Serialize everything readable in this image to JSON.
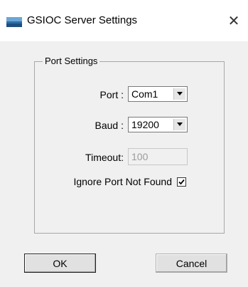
{
  "window": {
    "title": "GSIOC Server Settings",
    "close_glyph": "✕",
    "app_icon": "gsioc-app-icon"
  },
  "group": {
    "label": "Port Settings"
  },
  "port": {
    "label": "Port :",
    "value": "Com1"
  },
  "baud": {
    "label": "Baud :",
    "value": "19200"
  },
  "timeout": {
    "label": "Timeout:",
    "value": "100",
    "enabled": false
  },
  "ignore_port": {
    "label": "Ignore Port Not Found",
    "checked": true
  },
  "buttons": {
    "ok": "OK",
    "cancel": "Cancel"
  }
}
